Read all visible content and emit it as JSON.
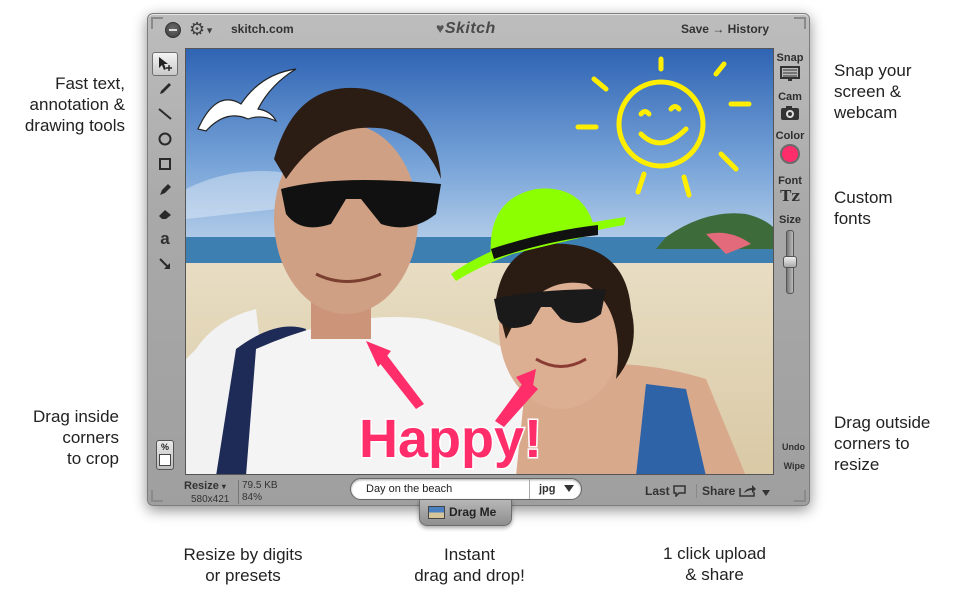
{
  "captions": {
    "left_top": "Fast text,\nannotation &\ndrawing tools",
    "left_bottom": "Drag inside\ncorners\nto crop",
    "right_top": "Snap your\nscreen &\nwebcam",
    "right_mid": "Custom\nfonts",
    "right_bottom": "Drag outside\ncorners to\nresize",
    "bottom_left": "Resize by digits\nor presets",
    "bottom_mid": "Instant\ndrag and drop!",
    "bottom_right": "1 click upload\n& share"
  },
  "titlebar": {
    "site": "skitch.com",
    "logo": "Skitch",
    "save_history": "Save → History"
  },
  "tools": [
    "pointer-move-icon",
    "pencil-icon",
    "line-icon",
    "ellipse-icon",
    "rectangle-icon",
    "highlighter-icon",
    "eraser-icon",
    "text-tool-icon",
    "arrow-icon"
  ],
  "right_panel": {
    "snap_label": "Snap",
    "cam_label": "Cam",
    "color_label": "Color",
    "color_value": "#ff2d6a",
    "font_label": "Font",
    "font_icon": "Tz",
    "size_label": "Size",
    "size_level": 0.5,
    "undo_label": "Undo",
    "wipe_label": "Wipe"
  },
  "crop_button": {
    "label": "%"
  },
  "canvas": {
    "annotation_text": "Happy!",
    "annotation_color": "#ff2d6a",
    "sun_color": "#ffee00",
    "hat_color": "#8cff00"
  },
  "bottombar": {
    "resize_label": "Resize",
    "dimensions": "580x421",
    "file_size": "79.5 KB",
    "zoom": "84%",
    "name_value": "Day on the beach",
    "format_value": "jpg",
    "last_label": "Last",
    "share_label": "Share"
  },
  "dragme": {
    "label": "Drag Me"
  }
}
